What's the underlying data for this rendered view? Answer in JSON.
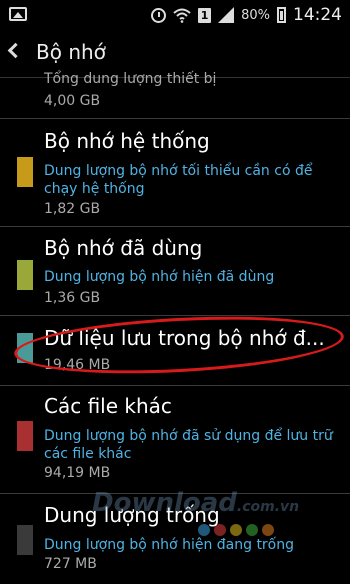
{
  "status_bar": {
    "battery": "80%",
    "sim_slot": "1",
    "time": "14:24"
  },
  "action_bar": {
    "title": "Bộ nhớ"
  },
  "total": {
    "label": "Tổng dung lượng thiết bị",
    "value": "4,00 GB"
  },
  "items": [
    {
      "name": "Bộ nhớ hệ thống",
      "desc": "Dung lượng bộ nhớ tối thiểu cần có để chạy hệ thống",
      "size": "1,82 GB",
      "color": "#c89a1a"
    },
    {
      "name": "Bộ nhớ đã dùng",
      "desc": "Dung lượng bộ nhớ hiện đã dùng",
      "size": "1,36 GB",
      "color": "#9aa83a"
    },
    {
      "name": "Dữ liệu lưu trong bộ nhớ đ...",
      "size": "19,46 MB",
      "color": "#4a9a9a"
    },
    {
      "name": "Các file khác",
      "desc": "Dung lượng bộ nhớ đã sử dụng để lưu trữ các file khác",
      "size": "94,19 MB",
      "color": "#a83030"
    },
    {
      "name": "Dung lượng trống",
      "desc": "Dung lượng bộ nhớ hiện đang trống",
      "size": "727 MB",
      "color": "#3a3a3a"
    }
  ],
  "watermark": {
    "text": "Download",
    "suffix": ".com.vn",
    "dot_colors": [
      "#3aa0e0",
      "#e04040",
      "#e0c020",
      "#40b040",
      "#e08020"
    ]
  }
}
